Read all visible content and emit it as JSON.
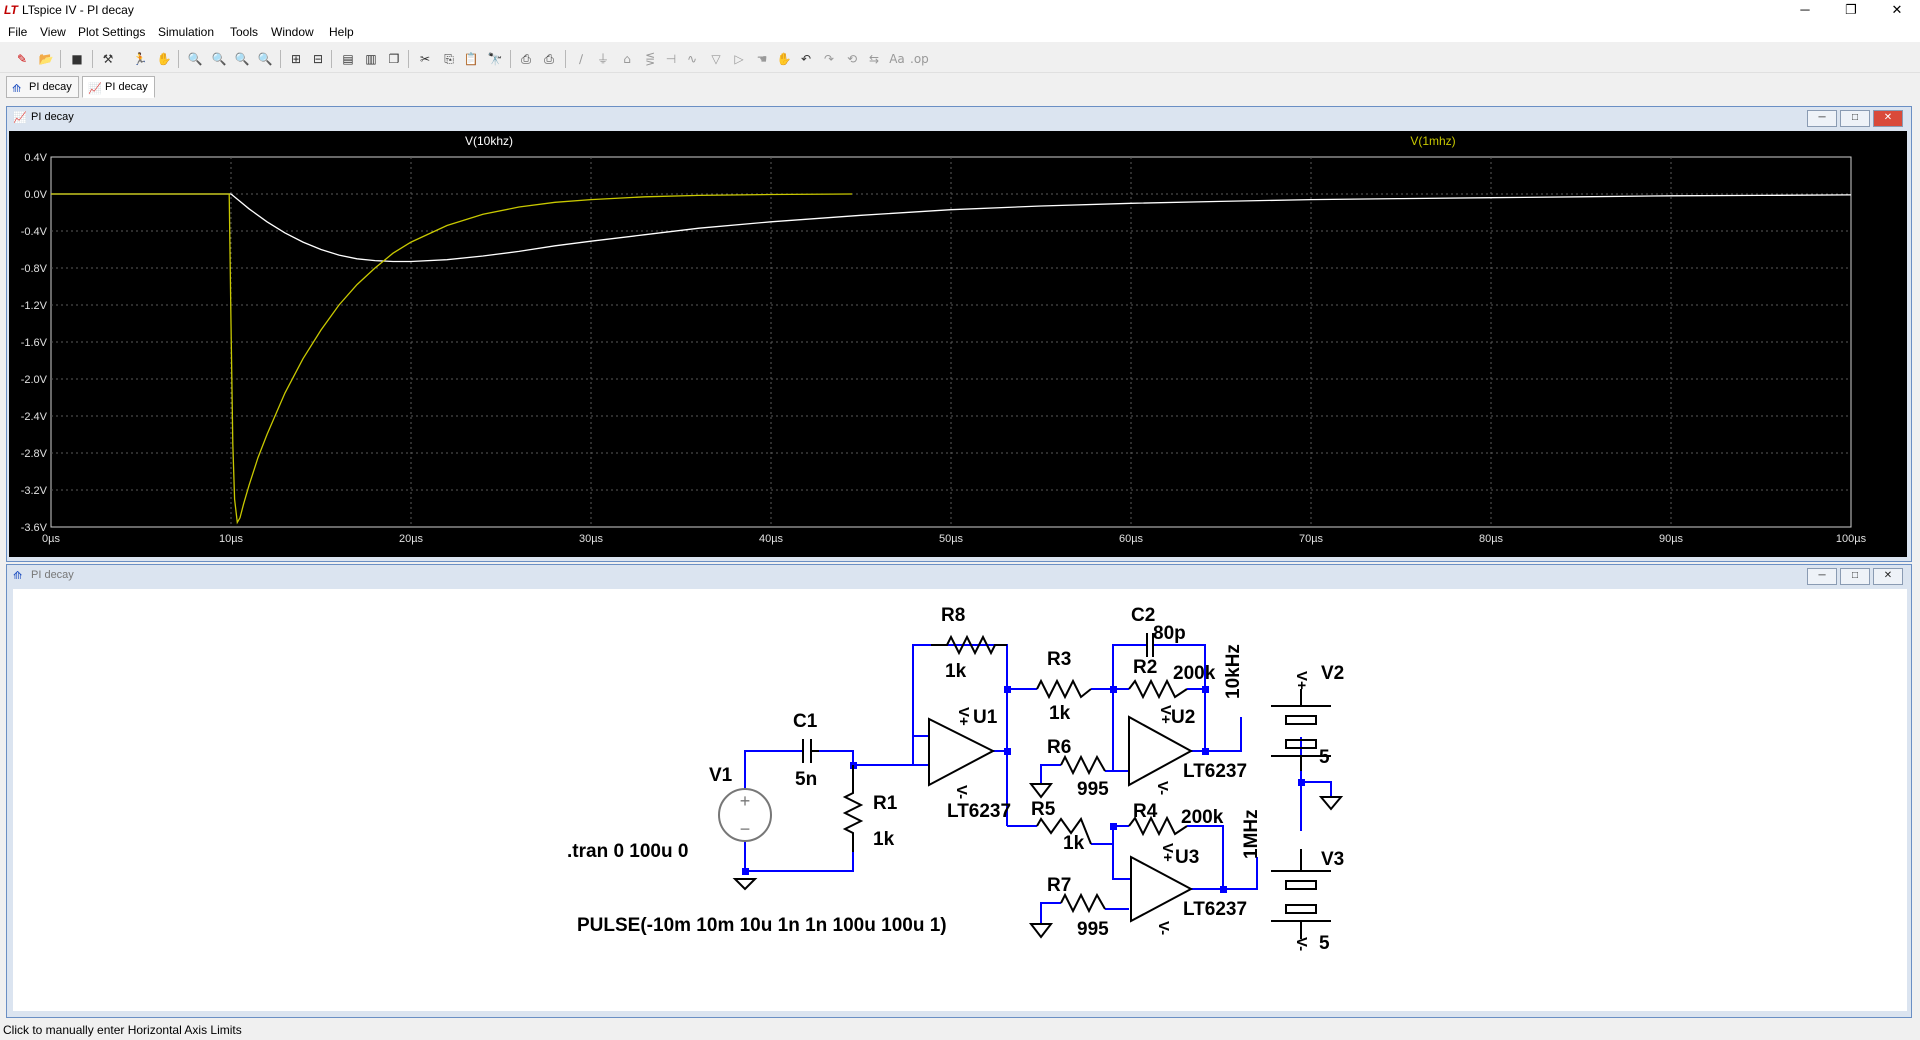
{
  "app": {
    "logo": "LT",
    "title": "LTspice IV - PI decay",
    "window_buttons": [
      "─",
      "❐",
      "✕"
    ]
  },
  "menu": [
    "File",
    "View",
    "Plot Settings",
    "Simulation",
    "Tools",
    "Window",
    "Help"
  ],
  "toolbar_icons": [
    "new-schematic-icon",
    "open-icon",
    "save-icon",
    "control-panel-icon",
    "run-icon",
    "halt-icon",
    "zoom-in-icon",
    "zoom-full-icon",
    "zoom-out-icon",
    "zoom-cancel-icon",
    "autorange-icon",
    "grid-icon",
    "tile-horizontal-icon",
    "tile-vertical-icon",
    "cascade-icon",
    "cut-icon",
    "copy-icon",
    "paste-icon",
    "find-icon",
    "print-preview-icon",
    "print-icon",
    "wire-icon",
    "ground-icon",
    "label-icon",
    "resistor-icon",
    "capacitor-icon",
    "inductor-icon",
    "diode-icon",
    "component-icon",
    "move-icon",
    "drag-icon",
    "undo-icon",
    "redo-icon",
    "rotate-icon",
    "mirror-icon",
    "text-icon",
    "spice-directive-icon"
  ],
  "tabs": [
    {
      "label": "PI decay",
      "icon": "schematic-icon",
      "active": false
    },
    {
      "label": "PI decay",
      "icon": "waveform-icon",
      "active": true
    }
  ],
  "waveform_window": {
    "title": "PI decay",
    "buttons": [
      "─",
      "□",
      "✕"
    ]
  },
  "schematic_window": {
    "title": "PI decay",
    "buttons": [
      "─",
      "□",
      "✕"
    ]
  },
  "colors": {
    "plot_bg": "#000000",
    "grid": "#5a5a5a",
    "trace_10khz": "#ffffff",
    "trace_1mhz": "#c8c800",
    "wire": "#0000ff",
    "component": "#000000"
  },
  "chart_data": {
    "type": "line",
    "x_unit": "µs",
    "xlim": [
      0,
      100
    ],
    "ylim": [
      -3.6,
      0.4
    ],
    "x_ticks": [
      "0µs",
      "10µs",
      "20µs",
      "30µs",
      "40µs",
      "50µs",
      "60µs",
      "70µs",
      "80µs",
      "90µs",
      "100µs"
    ],
    "y_ticks": [
      "0.4V",
      "0.0V",
      "-0.4V",
      "-0.8V",
      "-1.2V",
      "-1.6V",
      "-2.0V",
      "-2.4V",
      "-2.8V",
      "-3.2V",
      "-3.6V"
    ],
    "grid": true,
    "series": [
      {
        "name": "V(10khz)",
        "x": [
          0,
          10,
          10.5,
          11,
          12,
          13,
          14,
          15,
          16,
          17,
          18,
          19,
          20,
          22,
          24,
          26,
          28,
          30,
          33,
          36,
          40,
          45,
          50,
          55,
          60,
          65,
          70,
          75,
          80,
          85,
          90,
          95,
          100
        ],
        "y": [
          0,
          0,
          -0.08,
          -0.16,
          -0.3,
          -0.42,
          -0.52,
          -0.6,
          -0.66,
          -0.7,
          -0.72,
          -0.73,
          -0.73,
          -0.71,
          -0.67,
          -0.62,
          -0.56,
          -0.51,
          -0.44,
          -0.37,
          -0.3,
          -0.23,
          -0.17,
          -0.13,
          -0.1,
          -0.08,
          -0.06,
          -0.05,
          -0.04,
          -0.03,
          -0.02,
          -0.015,
          -0.01
        ]
      },
      {
        "name": "V(1mhz)",
        "x": [
          0,
          9.9,
          10,
          10.1,
          10.2,
          10.35,
          10.5,
          10.7,
          11,
          11.5,
          12,
          13,
          14,
          15,
          16,
          17,
          18,
          19,
          20,
          22,
          24,
          26,
          28,
          30,
          33,
          36,
          40,
          44.5
        ],
        "y": [
          0,
          0,
          -1.4,
          -2.7,
          -3.3,
          -3.55,
          -3.5,
          -3.35,
          -3.15,
          -2.85,
          -2.6,
          -2.15,
          -1.78,
          -1.47,
          -1.2,
          -0.98,
          -0.8,
          -0.64,
          -0.52,
          -0.34,
          -0.22,
          -0.14,
          -0.09,
          -0.06,
          -0.03,
          -0.015,
          -0.005,
          0
        ]
      }
    ]
  },
  "schematic": {
    "labels": {
      "R8": "R8",
      "R8v": "1k",
      "R3": "R3",
      "R3v": "1k",
      "C2": "C2",
      "C2v": "80p",
      "R2": "R2",
      "R2v": "200k",
      "net10k": "10kHz",
      "U1": "U1",
      "U1v": "LT6237",
      "U2": "U2",
      "U2v": "LT6237",
      "U3": "U3",
      "U3v": "LT6237",
      "R6": "R6",
      "R6v": "995",
      "R5": "R5",
      "R5v": "1k",
      "R4": "R4",
      "R4v": "200k",
      "net1M": "1MHz",
      "R7": "R7",
      "R7v": "995",
      "C1": "C1",
      "C1v": "5n",
      "V1": "V1",
      "R1": "R1",
      "R1v": "1k",
      "V2": "V2",
      "V2v": "5",
      "V3": "V3",
      "V3v": "5",
      "vplus": "V+",
      "vminus": "V-",
      "tran": ".tran 0 100u 0",
      "pulse": "PULSE(-10m 10m 10u 1n 1n 100u 100u 1)"
    }
  },
  "status": "Click to manually enter Horizontal Axis Limits"
}
